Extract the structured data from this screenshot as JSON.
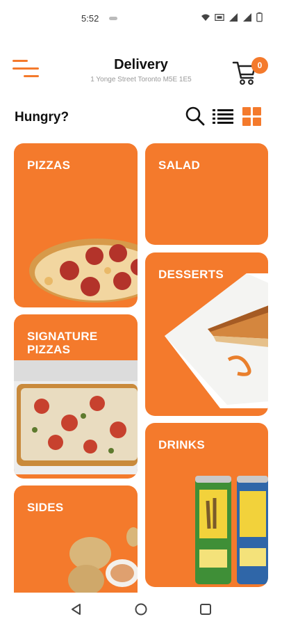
{
  "status": {
    "time": "5:52"
  },
  "header": {
    "title": "Delivery",
    "address": "1 Yonge Street   Toronto M5E 1E5",
    "cart_count": "0"
  },
  "toolbar": {
    "greeting": "Hungry?"
  },
  "categories": [
    {
      "label": "PIZZAS"
    },
    {
      "label": "SALAD"
    },
    {
      "label": "DESSERTS"
    },
    {
      "label": "SIGNATURE PIZZAS"
    },
    {
      "label": "DRINKS"
    },
    {
      "label": "SIDES"
    }
  ],
  "colors": {
    "accent": "#f47a2c"
  },
  "icons": [
    "menu-icon",
    "cart-icon",
    "search-icon",
    "list-view-icon",
    "grid-view-icon",
    "back-icon",
    "home-icon",
    "recents-icon"
  ]
}
